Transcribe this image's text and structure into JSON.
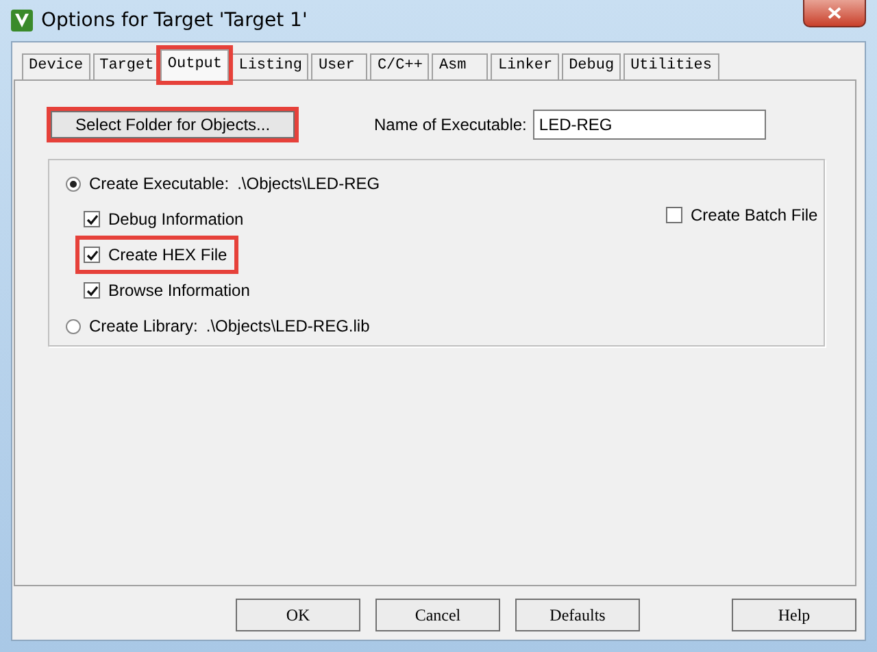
{
  "window": {
    "title": "Options for Target 'Target 1'"
  },
  "tabs": [
    {
      "label": "Device",
      "selected": false,
      "highlighted": false
    },
    {
      "label": "Target",
      "selected": false,
      "highlighted": false
    },
    {
      "label": "Output",
      "selected": true,
      "highlighted": true
    },
    {
      "label": "Listing",
      "selected": false,
      "highlighted": false
    },
    {
      "label": "User",
      "selected": false,
      "highlighted": false
    },
    {
      "label": "C/C++",
      "selected": false,
      "highlighted": false
    },
    {
      "label": "Asm",
      "selected": false,
      "highlighted": false
    },
    {
      "label": "Linker",
      "selected": false,
      "highlighted": false
    },
    {
      "label": "Debug",
      "selected": false,
      "highlighted": false
    },
    {
      "label": "Utilities",
      "selected": false,
      "highlighted": false
    }
  ],
  "folder_button": {
    "label": "Select Folder for Objects...",
    "highlighted": true
  },
  "executable_name": {
    "label": "Name of Executable:",
    "value": "LED-REG"
  },
  "create_executable": {
    "label": "Create Executable:",
    "path": ".\\Objects\\LED-REG",
    "selected": true
  },
  "options": [
    {
      "label": "Debug Information",
      "checked": true,
      "highlighted": false
    },
    {
      "label": "Create HEX File",
      "checked": true,
      "highlighted": true
    },
    {
      "label": "Browse Information",
      "checked": true,
      "highlighted": false
    }
  ],
  "batch_file": {
    "label": "Create Batch File",
    "checked": false
  },
  "create_library": {
    "label": "Create Library:",
    "path": ".\\Objects\\LED-REG.lib",
    "selected": false
  },
  "buttons": [
    {
      "label": "OK"
    },
    {
      "label": "Cancel"
    },
    {
      "label": "Defaults"
    },
    {
      "label": "Help"
    }
  ]
}
